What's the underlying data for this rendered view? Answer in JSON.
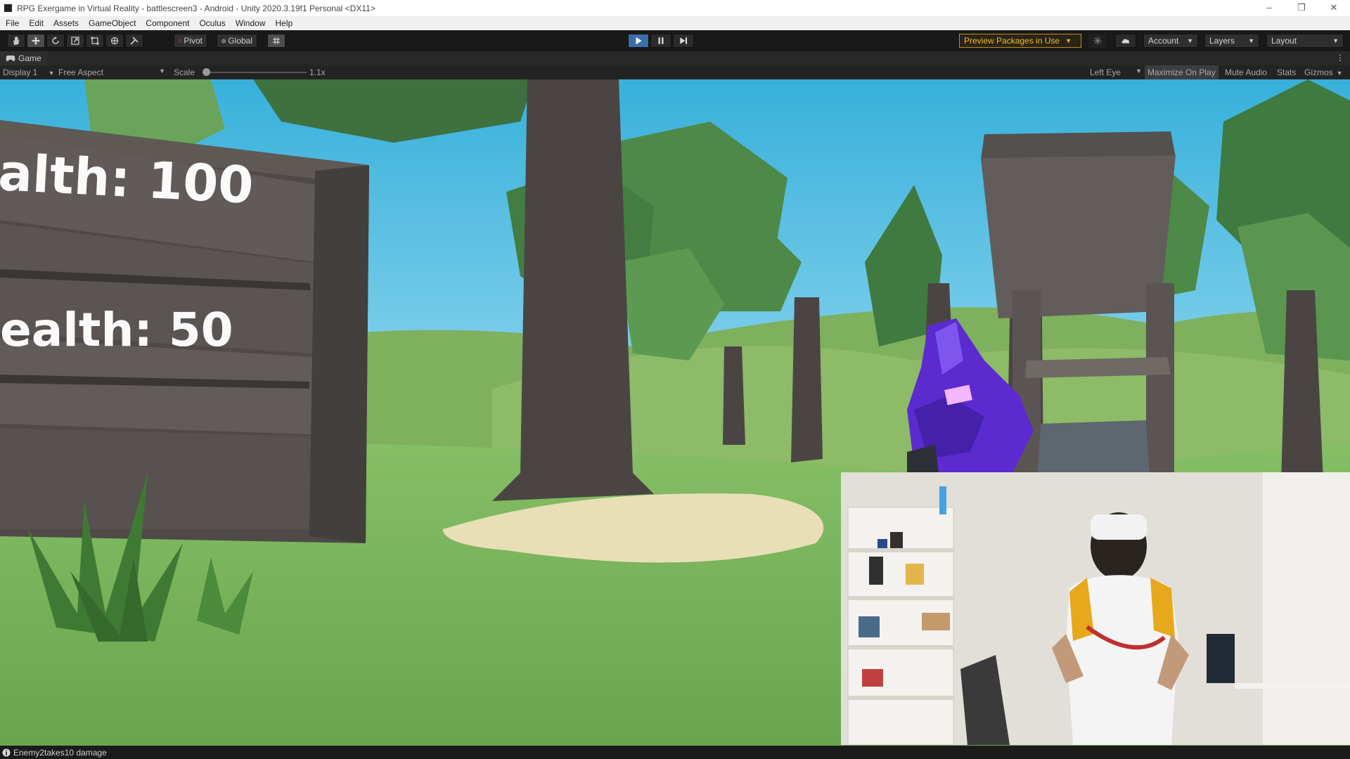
{
  "window": {
    "title": "RPG Exergame in Virtual Reality - battlescreen3 - Android - Unity 2020.3.19f1 Personal <DX11>",
    "controls": [
      "–",
      "❐",
      "✕"
    ]
  },
  "menu": [
    "File",
    "Edit",
    "Assets",
    "GameObject",
    "Component",
    "Oculus",
    "Window",
    "Help"
  ],
  "toolbar": {
    "pivot_label": "Pivot",
    "global_label": "Global",
    "preview_packages_label": "Preview Packages in Use",
    "account_label": "Account",
    "layers_label": "Layers",
    "layout_label": "Layout",
    "accent_color": "#3a6ea8",
    "warning_color": "#f2b833"
  },
  "game_view": {
    "tab_label": "Game",
    "display_label": "Display 1",
    "aspect_label": "Free Aspect",
    "scale_label": "Scale",
    "scale_value_label": "1.1x",
    "scale_value": 1.1,
    "eye_label": "Left Eye",
    "maximize_label": "Maximize On Play",
    "mute_label": "Mute Audio",
    "stats_label": "Stats",
    "gizmos_label": "Gizmos"
  },
  "scene": {
    "sign_line_1": "alth: 100",
    "sign_line_2": "ealth: 50",
    "sky_color": "#3cb6dd",
    "grass_color": "#7fb860"
  },
  "status": {
    "message": "Enemy2takes10 damage"
  }
}
